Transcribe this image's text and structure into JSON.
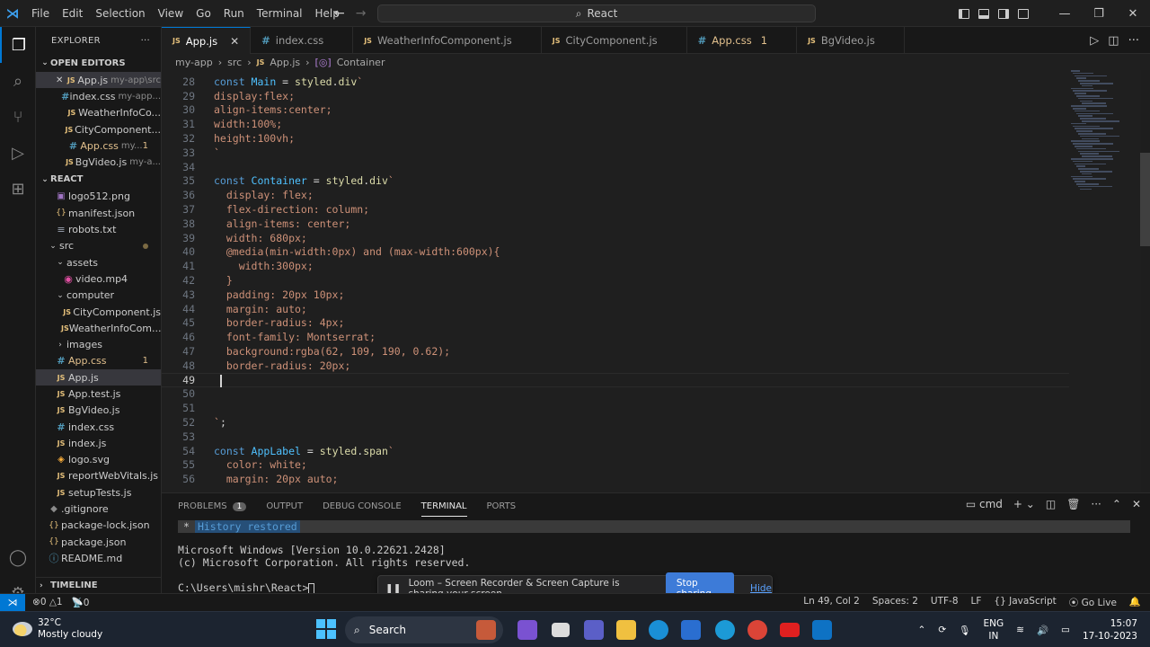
{
  "menu": [
    "File",
    "Edit",
    "Selection",
    "View",
    "Go",
    "Run",
    "Terminal",
    "Help"
  ],
  "command_center": "React",
  "explorer": {
    "title": "EXPLORER",
    "open_editors_label": "OPEN EDITORS",
    "open_editors": [
      {
        "name": "App.js",
        "desc": "my-app\\src",
        "icon": "js",
        "close": "✕",
        "selected": true
      },
      {
        "name": "index.css",
        "desc": "my-app...",
        "icon": "css"
      },
      {
        "name": "WeatherInfoCo...",
        "desc": "",
        "icon": "js"
      },
      {
        "name": "CityComponent...",
        "desc": "",
        "icon": "js"
      },
      {
        "name": "App.css",
        "desc": "my...",
        "icon": "css",
        "badge": "1"
      },
      {
        "name": "BgVideo.js",
        "desc": "my-a...",
        "icon": "js"
      }
    ],
    "project_label": "REACT",
    "tree": [
      {
        "name": "logo512.png",
        "icon": "img",
        "indent": 1
      },
      {
        "name": "manifest.json",
        "icon": "json",
        "indent": 1
      },
      {
        "name": "robots.txt",
        "icon": "txt",
        "indent": 1
      },
      {
        "name": "src",
        "icon": "folder",
        "indent": 0,
        "open": true,
        "dot": true
      },
      {
        "name": "assets",
        "icon": "folder",
        "indent": 1,
        "open": true
      },
      {
        "name": "video.mp4",
        "icon": "mp4",
        "indent": 2
      },
      {
        "name": "computer",
        "icon": "folder",
        "indent": 1,
        "open": true
      },
      {
        "name": "CityComponent.js",
        "icon": "js",
        "indent": 2
      },
      {
        "name": "WeatherInfoCom...",
        "icon": "js",
        "indent": 2
      },
      {
        "name": "images",
        "icon": "folder",
        "indent": 1,
        "open": false
      },
      {
        "name": "App.css",
        "icon": "css",
        "indent": 1,
        "badge": "1",
        "modified": true
      },
      {
        "name": "App.js",
        "icon": "js",
        "indent": 1,
        "selected": true
      },
      {
        "name": "App.test.js",
        "icon": "js",
        "indent": 1
      },
      {
        "name": "BgVideo.js",
        "icon": "js",
        "indent": 1
      },
      {
        "name": "index.css",
        "icon": "css",
        "indent": 1
      },
      {
        "name": "index.js",
        "icon": "js",
        "indent": 1
      },
      {
        "name": "logo.svg",
        "icon": "svg",
        "indent": 1
      },
      {
        "name": "reportWebVitals.js",
        "icon": "js",
        "indent": 1
      },
      {
        "name": "setupTests.js",
        "icon": "js",
        "indent": 1
      },
      {
        "name": ".gitignore",
        "icon": "git",
        "indent": 0
      },
      {
        "name": "package-lock.json",
        "icon": "json",
        "indent": 0
      },
      {
        "name": "package.json",
        "icon": "json",
        "indent": 0
      },
      {
        "name": "README.md",
        "icon": "info",
        "indent": 0
      }
    ],
    "timeline_label": "TIMELINE"
  },
  "tabs": [
    {
      "label": "App.js",
      "icon": "JS",
      "active": true,
      "close": "✕"
    },
    {
      "label": "index.css",
      "icon": "#"
    },
    {
      "label": "WeatherInfoComponent.js",
      "icon": "JS"
    },
    {
      "label": "CityComponent.js",
      "icon": "JS"
    },
    {
      "label": "App.css",
      "icon": "#",
      "badge": "1",
      "modified": true
    },
    {
      "label": "BgVideo.js",
      "icon": "JS"
    }
  ],
  "breadcrumb": [
    "my-app",
    "src",
    "App.js",
    "Container"
  ],
  "code": [
    {
      "n": "28",
      "t": [
        [
          "k",
          "const "
        ],
        [
          "v",
          "Main"
        ],
        [
          "p",
          " = "
        ],
        [
          "f",
          "styled"
        ],
        [
          "p",
          "."
        ],
        [
          "f",
          "div"
        ],
        [
          "s",
          "`"
        ]
      ]
    },
    {
      "n": "29",
      "t": [
        [
          "s",
          "display:flex;"
        ]
      ]
    },
    {
      "n": "30",
      "t": [
        [
          "s",
          "align-items:center;"
        ]
      ]
    },
    {
      "n": "31",
      "t": [
        [
          "s",
          "width:100%;"
        ]
      ]
    },
    {
      "n": "32",
      "t": [
        [
          "s",
          "height:100vh;"
        ]
      ]
    },
    {
      "n": "33",
      "t": [
        [
          "s",
          "`"
        ]
      ]
    },
    {
      "n": "34",
      "t": []
    },
    {
      "n": "35",
      "t": [
        [
          "k",
          "const "
        ],
        [
          "v",
          "Container"
        ],
        [
          "p",
          " = "
        ],
        [
          "f",
          "styled"
        ],
        [
          "p",
          "."
        ],
        [
          "f",
          "div"
        ],
        [
          "s",
          "`"
        ]
      ]
    },
    {
      "n": "36",
      "t": [
        [
          "s",
          "  display: flex;"
        ]
      ]
    },
    {
      "n": "37",
      "t": [
        [
          "s",
          "  flex-direction: column;"
        ]
      ]
    },
    {
      "n": "38",
      "t": [
        [
          "s",
          "  align-items: center;"
        ]
      ]
    },
    {
      "n": "39",
      "t": [
        [
          "s",
          "  width: 680px;"
        ]
      ]
    },
    {
      "n": "40",
      "t": [
        [
          "s",
          "  @media(min-width:0px) and (max-width:600px){"
        ]
      ]
    },
    {
      "n": "41",
      "t": [
        [
          "s",
          "    width:300px;"
        ]
      ]
    },
    {
      "n": "42",
      "t": [
        [
          "s",
          "  }"
        ]
      ]
    },
    {
      "n": "43",
      "t": [
        [
          "s",
          "  padding: 20px 10px;"
        ]
      ]
    },
    {
      "n": "44",
      "t": [
        [
          "s",
          "  margin: auto;"
        ]
      ]
    },
    {
      "n": "45",
      "t": [
        [
          "s",
          "  border-radius: 4px;"
        ]
      ]
    },
    {
      "n": "46",
      "t": [
        [
          "s",
          "  font-family: Montserrat;"
        ]
      ]
    },
    {
      "n": "47",
      "t": [
        [
          "s",
          "  background:rgba(62, 109, 190, 0.62);"
        ]
      ]
    },
    {
      "n": "48",
      "t": [
        [
          "s",
          "  border-radius: 20px;"
        ]
      ]
    },
    {
      "n": "49",
      "t": [],
      "current": true
    },
    {
      "n": "50",
      "t": []
    },
    {
      "n": "51",
      "t": []
    },
    {
      "n": "52",
      "t": [
        [
          "s",
          "`"
        ],
        [
          "p",
          ";"
        ]
      ]
    },
    {
      "n": "53",
      "t": []
    },
    {
      "n": "54",
      "t": [
        [
          "k",
          "const "
        ],
        [
          "v",
          "AppLabel"
        ],
        [
          "p",
          " = "
        ],
        [
          "f",
          "styled"
        ],
        [
          "p",
          "."
        ],
        [
          "f",
          "span"
        ],
        [
          "s",
          "`"
        ]
      ]
    },
    {
      "n": "55",
      "t": [
        [
          "s",
          "  color: white;"
        ]
      ]
    },
    {
      "n": "56",
      "t": [
        [
          "s",
          "  margin: 20px auto;"
        ]
      ]
    }
  ],
  "panel": {
    "tabs": [
      "PROBLEMS",
      "OUTPUT",
      "DEBUG CONSOLE",
      "TERMINAL",
      "PORTS"
    ],
    "problems_count": "1",
    "active": "TERMINAL",
    "shell": "cmd",
    "history_restored": "History restored",
    "lines": [
      "Microsoft Windows [Version 10.0.22621.2428]",
      "(c) Microsoft Corporation. All rights reserved.",
      "",
      "C:\\Users\\mishr\\React>"
    ]
  },
  "loom": {
    "message": "Loom – Screen Recorder & Screen Capture is sharing your screen.",
    "stop_label": "Stop sharing",
    "hide_label": "Hide"
  },
  "status": {
    "errors": "0",
    "warnings": "1",
    "ports": "0",
    "position": "Ln 49, Col 2",
    "spaces": "Spaces: 2",
    "encoding": "UTF-8",
    "eol": "LF",
    "language": "JavaScript",
    "golive": "Go Live"
  },
  "taskbar": {
    "temp": "32°C",
    "weather": "Mostly cloudy",
    "search": "Search",
    "lang1": "ENG",
    "lang2": "IN",
    "time": "15:07",
    "date": "17-10-2023"
  }
}
